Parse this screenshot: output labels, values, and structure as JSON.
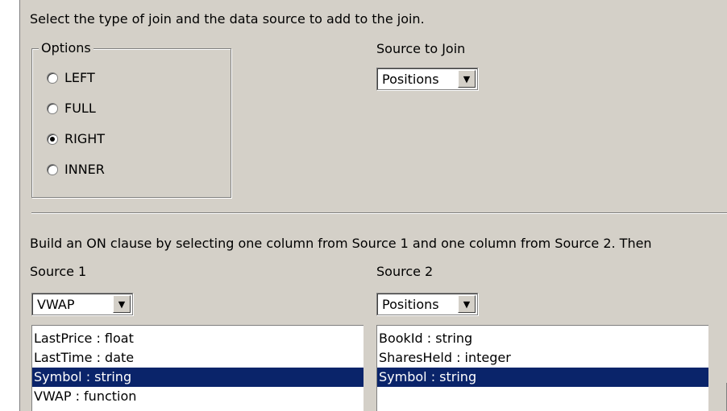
{
  "header": {
    "instruction": "Select the type of join and the data source to add to the join."
  },
  "options": {
    "legend": "Options",
    "items": [
      {
        "label": "LEFT",
        "checked": false
      },
      {
        "label": "FULL",
        "checked": false
      },
      {
        "label": "RIGHT",
        "checked": true
      },
      {
        "label": "INNER",
        "checked": false
      }
    ]
  },
  "source_to_join": {
    "label": "Source to Join",
    "value": "Positions"
  },
  "on_clause": {
    "instruction": "Build an ON clause by selecting one column from Source 1 and one column from Source 2. Then"
  },
  "source1": {
    "label": "Source 1",
    "value": "VWAP",
    "columns": [
      {
        "text": "LastPrice : float",
        "selected": false
      },
      {
        "text": "LastTime : date",
        "selected": false
      },
      {
        "text": "Symbol : string",
        "selected": true
      },
      {
        "text": "VWAP : function",
        "selected": false
      }
    ]
  },
  "source2": {
    "label": "Source 2",
    "value": "Positions",
    "columns": [
      {
        "text": "BookId : string",
        "selected": false
      },
      {
        "text": "SharesHeld : integer",
        "selected": false
      },
      {
        "text": "Symbol : string",
        "selected": true
      }
    ]
  },
  "icons": {
    "dropdown_arrow": "chevron-down-icon"
  }
}
